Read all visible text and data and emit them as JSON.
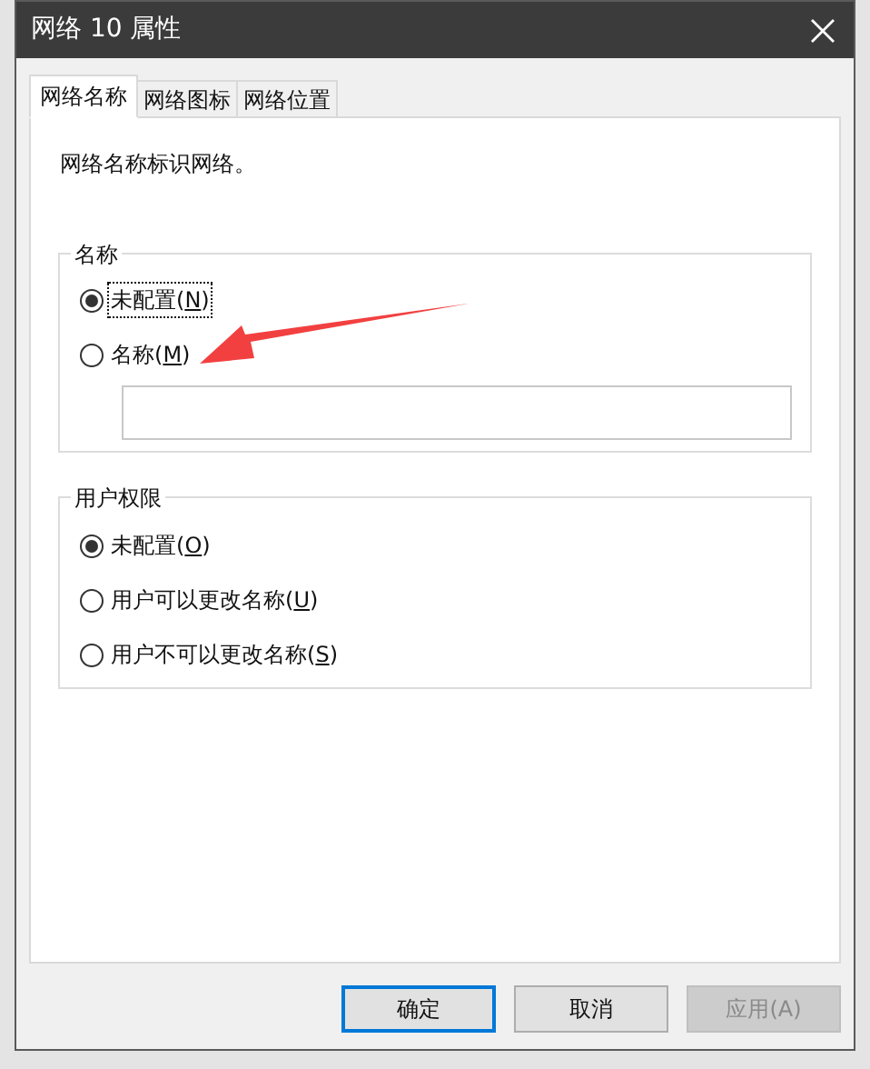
{
  "window": {
    "title": "网络 10 属性"
  },
  "tabs": [
    {
      "label": "网络名称",
      "selected": true
    },
    {
      "label": "网络图标",
      "selected": false
    },
    {
      "label": "网络位置",
      "selected": false
    }
  ],
  "description": "网络名称标识网络。",
  "name_group": {
    "title": "名称",
    "options": [
      {
        "label": "未配置(N)",
        "selected": true,
        "focused": true
      },
      {
        "label": "名称(M)",
        "selected": false,
        "focused": false
      }
    ]
  },
  "permission_group": {
    "title": "用户权限",
    "options": [
      {
        "label": "未配置(O)",
        "selected": true
      },
      {
        "label": "用户可以更改名称(U)",
        "selected": false
      },
      {
        "label": "用户不可以更改名称(S)",
        "selected": false
      }
    ]
  },
  "buttons": [
    {
      "label": "确定",
      "default": true,
      "disabled": false
    },
    {
      "label": "取消",
      "default": false,
      "disabled": false
    },
    {
      "label": "应用(A)",
      "default": false,
      "disabled": true
    }
  ]
}
